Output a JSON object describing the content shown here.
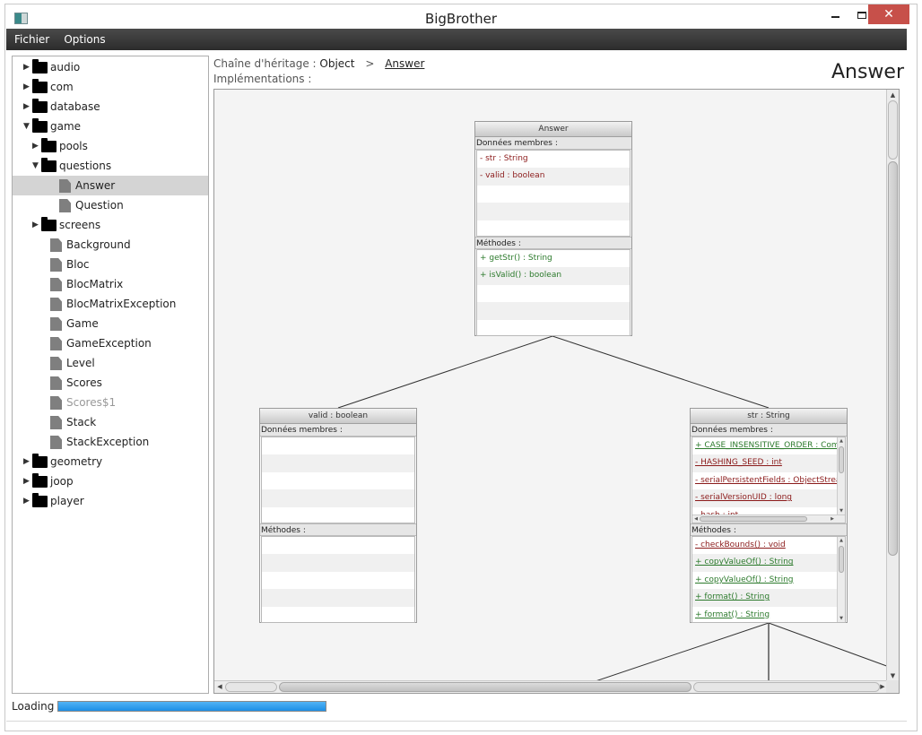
{
  "window": {
    "title": "BigBrother",
    "controls": {
      "minimize": "minimize",
      "maximize": "maximize",
      "close": "✕"
    }
  },
  "menu": [
    "Fichier",
    "Options"
  ],
  "tree": [
    {
      "label": "audio",
      "type": "folder",
      "depth": 0,
      "expanded": false
    },
    {
      "label": "com",
      "type": "folder",
      "depth": 0,
      "expanded": false
    },
    {
      "label": "database",
      "type": "folder",
      "depth": 0,
      "expanded": false
    },
    {
      "label": "game",
      "type": "folder",
      "depth": 0,
      "expanded": true
    },
    {
      "label": "pools",
      "type": "folder",
      "depth": 1,
      "expanded": false
    },
    {
      "label": "questions",
      "type": "folder",
      "depth": 1,
      "expanded": true
    },
    {
      "label": "Answer",
      "type": "file",
      "depth": 2,
      "selected": true
    },
    {
      "label": "Question",
      "type": "file",
      "depth": 2
    },
    {
      "label": "screens",
      "type": "folder",
      "depth": 1,
      "expanded": false
    },
    {
      "label": "Background",
      "type": "file",
      "depth": 1
    },
    {
      "label": "Bloc",
      "type": "file",
      "depth": 1
    },
    {
      "label": "BlocMatrix",
      "type": "file",
      "depth": 1
    },
    {
      "label": "BlocMatrixException",
      "type": "file",
      "depth": 1
    },
    {
      "label": "Game",
      "type": "file",
      "depth": 1
    },
    {
      "label": "GameException",
      "type": "file",
      "depth": 1
    },
    {
      "label": "Level",
      "type": "file",
      "depth": 1
    },
    {
      "label": "Scores",
      "type": "file",
      "depth": 1
    },
    {
      "label": "Scores$1",
      "type": "file",
      "depth": 1,
      "dim": true
    },
    {
      "label": "Stack",
      "type": "file",
      "depth": 1
    },
    {
      "label": "StackException",
      "type": "file",
      "depth": 1
    },
    {
      "label": "geometry",
      "type": "folder",
      "depth": 0,
      "expanded": false
    },
    {
      "label": "joop",
      "type": "folder",
      "depth": 0,
      "expanded": false
    },
    {
      "label": "player",
      "type": "folder",
      "depth": 0,
      "expanded": false
    }
  ],
  "header": {
    "chain_label": "Chaîne d'héritage :",
    "chain": [
      "Object",
      "Answer"
    ],
    "chain_sep": ">",
    "impl_label": "Implémentations :",
    "class_title": "Answer"
  },
  "uml": {
    "fields_label": "Données membres :",
    "methods_label": "Méthodes :",
    "boxes": [
      {
        "id": "answer",
        "title": "Answer",
        "fields": [
          {
            "text": "- str : String",
            "vis": "private"
          },
          {
            "text": "- valid : boolean",
            "vis": "private"
          }
        ],
        "methods": [
          {
            "text": "+ getStr() : String",
            "vis": "public"
          },
          {
            "text": "+ isValid() : boolean",
            "vis": "public"
          }
        ]
      },
      {
        "id": "valid",
        "title": "valid : boolean",
        "fields": [],
        "methods": []
      },
      {
        "id": "str",
        "title": "str : String",
        "fields": [
          {
            "text": "+ CASE_INSENSITIVE_ORDER : Comparator",
            "vis": "public",
            "static": true
          },
          {
            "text": "- HASHING_SEED : int",
            "vis": "private",
            "static": true
          },
          {
            "text": "- serialPersistentFields : ObjectStreamField[]",
            "vis": "private",
            "static": true
          },
          {
            "text": "- serialVersionUID : long",
            "vis": "private",
            "static": true
          },
          {
            "text": "- hash : int",
            "vis": "private"
          }
        ],
        "methods": [
          {
            "text": "- checkBounds() : void",
            "vis": "private",
            "static": true
          },
          {
            "text": "+ copyValueOf() : String",
            "vis": "public",
            "static": true
          },
          {
            "text": "+ copyValueOf() : String",
            "vis": "public",
            "static": true
          },
          {
            "text": "+ format() : String",
            "vis": "public",
            "static": true
          },
          {
            "text": "+ format() : String",
            "vis": "public",
            "static": true
          }
        ]
      }
    ]
  },
  "status": {
    "label": "Loading :",
    "progress": 1.0
  }
}
